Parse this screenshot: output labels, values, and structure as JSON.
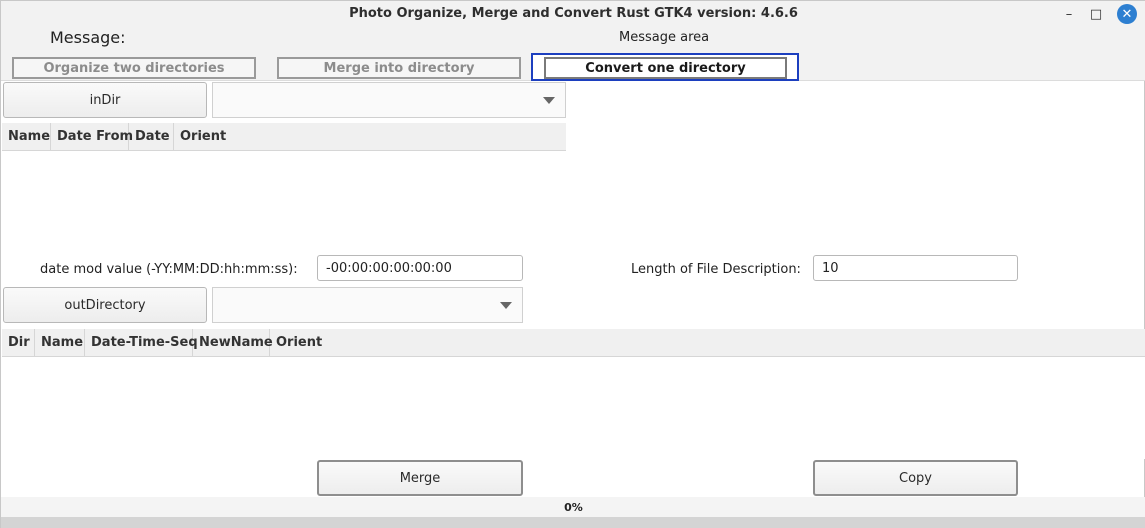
{
  "window": {
    "title": "Photo Organize, Merge and Convert Rust GTK4 version: 4.6.6",
    "minimize_glyph": "–",
    "maximize_glyph": "□",
    "close_glyph": "✕"
  },
  "header": {
    "message_label": "Message:",
    "message_area": "Message area"
  },
  "tabs": [
    {
      "label": "Organize two directories",
      "active": false
    },
    {
      "label": "Merge into directory",
      "active": false
    },
    {
      "label": "Convert one directory",
      "active": true
    }
  ],
  "in_dir": {
    "button_label": "inDir",
    "selected_value": "",
    "columns": [
      "Name",
      "Date From",
      "Date",
      "Orient"
    ]
  },
  "date_mod": {
    "label": "date mod value (-YY:MM:DD:hh:mm:ss):",
    "value": "-00:00:00:00:00:00"
  },
  "file_desc": {
    "label": "Length of File Description:",
    "value": "10"
  },
  "out_dir": {
    "button_label": "outDirectory",
    "selected_value": "",
    "columns": [
      "Dir",
      "Name",
      "Date-Time-Seq",
      "NewName",
      "Orient"
    ]
  },
  "actions": {
    "merge_label": "Merge",
    "copy_label": "Copy"
  },
  "progress": {
    "text": "0%",
    "fraction": 0
  },
  "colors": {
    "active_tab_border": "#1c3fbf",
    "close_button": "#2d7fd1"
  }
}
